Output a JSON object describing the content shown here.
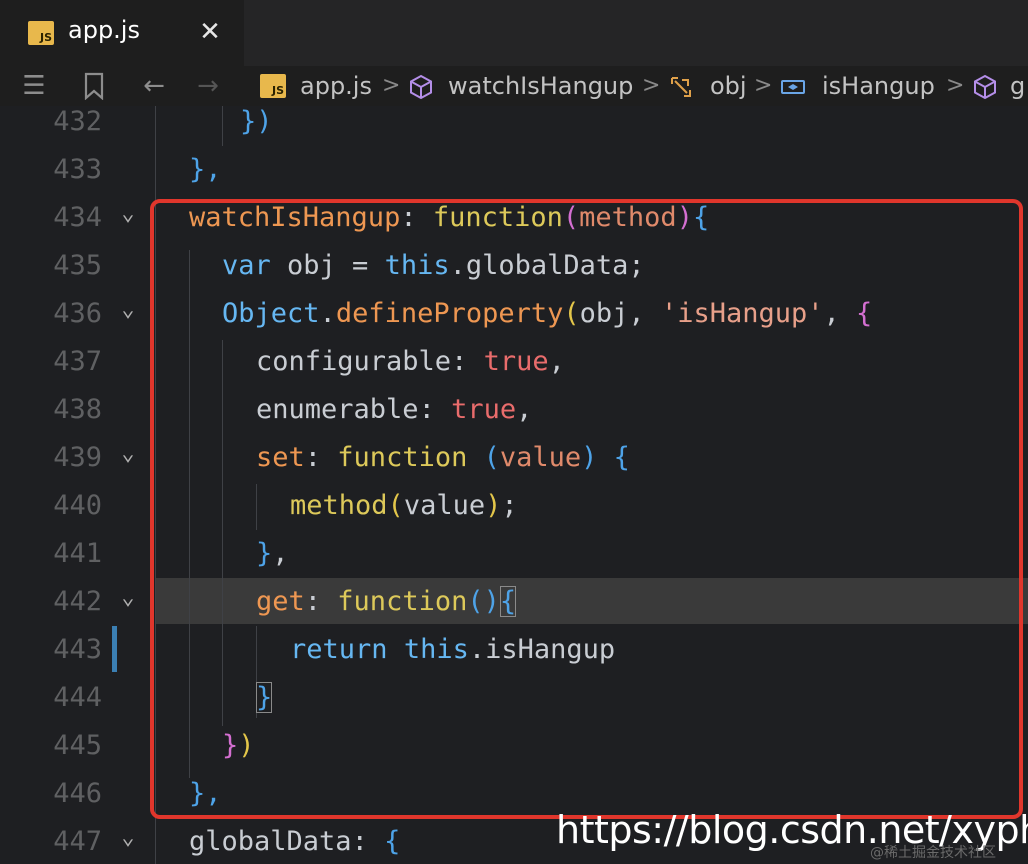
{
  "tab": {
    "badge": "JS",
    "title": "app.js",
    "close": "✕"
  },
  "toolbar": {
    "menu_glyph": "☰",
    "bookmark_glyph": "⚑",
    "back_glyph": "←",
    "forward_glyph": "→"
  },
  "breadcrumb": {
    "items": [
      "app.js",
      "watchIsHangup",
      "obj",
      "isHangup",
      "g"
    ],
    "separator": ">"
  },
  "editor": {
    "lines": [
      {
        "num": "432"
      },
      {
        "num": "433"
      },
      {
        "num": "434"
      },
      {
        "num": "435"
      },
      {
        "num": "436"
      },
      {
        "num": "437"
      },
      {
        "num": "438"
      },
      {
        "num": "439"
      },
      {
        "num": "440"
      },
      {
        "num": "441"
      },
      {
        "num": "442"
      },
      {
        "num": "443"
      },
      {
        "num": "444"
      },
      {
        "num": "445"
      },
      {
        "num": "446"
      },
      {
        "num": "447"
      }
    ],
    "fold_glyph": "⌄",
    "tokens": {
      "close_paren": "})",
      "close_brace_comma": "},",
      "watch_name": "watchIsHangup",
      "colon": ": ",
      "function_kw": "function",
      "open_paren": "(",
      "method_param": "method",
      "close_paren_single": ")",
      "open_brace": "{",
      "var_kw": "var",
      "obj": " obj = ",
      "this_kw": "this",
      "global_data_access": ".globalData;",
      "object_name": "Object",
      "dot": ".",
      "define_property": "defineProperty",
      "obj_arg": "obj, ",
      "is_hangup_str": "'isHangup'",
      "comma_space": ", ",
      "configurable": "configurable",
      "true_kw": "true",
      "comma": ",",
      "enumerable": "enumerable",
      "set_prop": "set",
      "function_space_paren": " (",
      "value_param": "value",
      "method_call": "method",
      "value_arg": "value",
      "semicolon": ";",
      "close_brace": "}",
      "get_prop": "get",
      "empty_parens": "()",
      "return_kw": "return",
      "is_hangup_access": ".isHangup",
      "global_data_prop": "globalData",
      "colon_space": ": "
    }
  },
  "watermark": {
    "main": "https://blog.csdn.net/xyphf",
    "sub": "@稀土掘金技术社区"
  }
}
